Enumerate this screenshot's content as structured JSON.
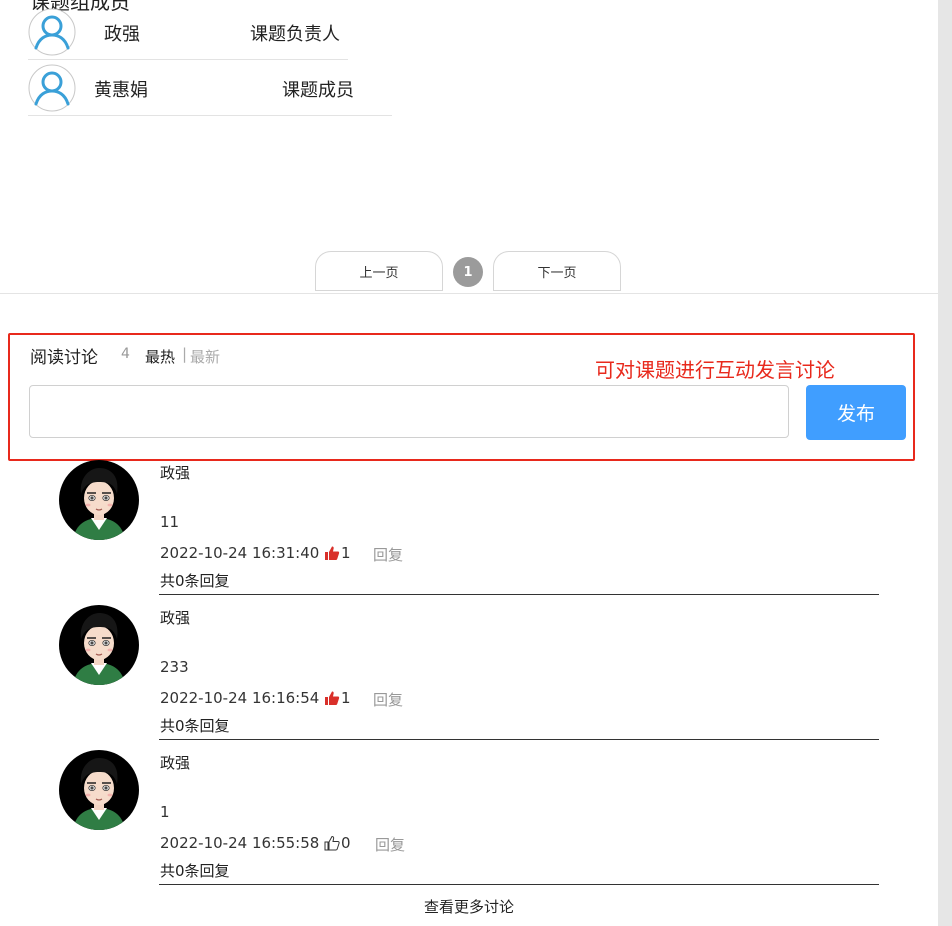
{
  "members": {
    "section_title": "课题组成员",
    "rows": [
      {
        "name": "政强",
        "role": "课题负责人"
      },
      {
        "name": "黄惠娟",
        "role": "课题成员"
      }
    ]
  },
  "pagination": {
    "prev_label": "上一页",
    "current_page": "1",
    "next_label": "下一页"
  },
  "discussion": {
    "title": "阅读讨论",
    "count": "4",
    "sort_hot": "最热",
    "sort_separator": "|",
    "sort_new": "最新",
    "annotation": "可对课题进行互动发言讨论",
    "input_value": "",
    "publish_label": "发布",
    "reply_label": "回复",
    "comments": [
      {
        "author": "政强",
        "text": "11",
        "time": "2022-10-24 16:31:40",
        "likes": "1",
        "liked": true,
        "replies": "共0条回复"
      },
      {
        "author": "政强",
        "text": "233",
        "time": "2022-10-24 16:16:54",
        "likes": "1",
        "liked": true,
        "replies": "共0条回复"
      },
      {
        "author": "政强",
        "text": "1",
        "time": "2022-10-24 16:55:58",
        "likes": "0",
        "liked": false,
        "replies": "共0条回复"
      }
    ],
    "more_label": "查看更多讨论"
  },
  "colors": {
    "accent": "#409eff",
    "annotation_red": "#e8291c",
    "liked_red": "#d9302a",
    "user_icon_blue": "#3aa0d8"
  },
  "icons": {
    "member_avatar": "user-outline-icon",
    "like_active": "thumbs-up-filled-icon",
    "like_inactive": "thumbs-up-outline-icon"
  }
}
